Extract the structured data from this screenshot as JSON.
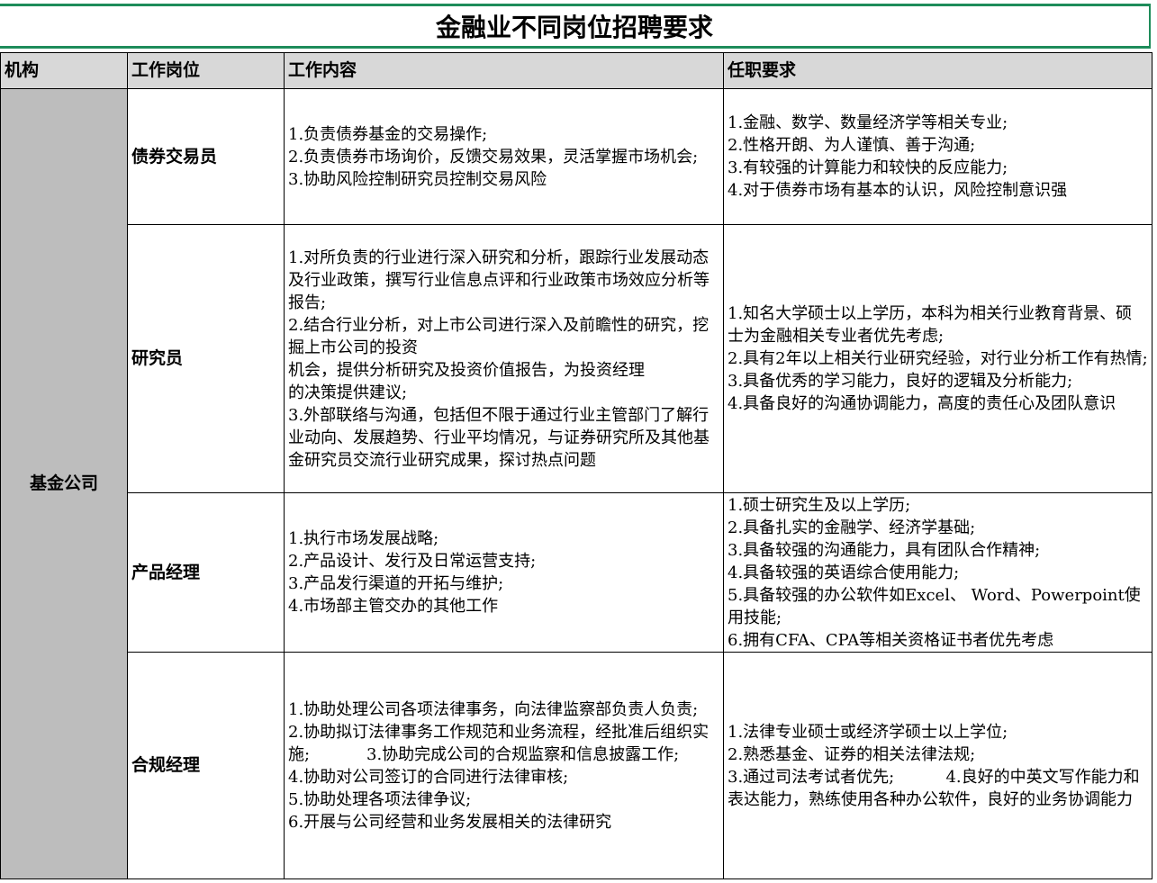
{
  "title": "金融业不同岗位招聘要求",
  "headers": {
    "org": "机构",
    "position": "工作岗位",
    "content": "工作内容",
    "requirements": "任职要求"
  },
  "org_name": "基金公司",
  "rows": [
    {
      "position": "债券交易员",
      "content": [
        "1.负责债券基金的交易操作;",
        "2.负责债券市场询价，反馈交易效果，灵活掌握市场机会;",
        "3.协助风险控制研究员控制交易风险"
      ],
      "requirements": [
        "1.金融、数学、数量经济学等相关专业;",
        "2.性格开朗、为人谨慎、善于沟通;",
        "3.有较强的计算能力和较快的反应能力;",
        "4.对于债券市场有基本的认识，风险控制意识强"
      ]
    },
    {
      "position": "研究员",
      "content": [
        "1.对所负责的行业进行深入研究和分析，跟踪行业发展动态及行业政策，撰写行业信息点评和行业政策市场效应分析等报告;",
        "2.结合行业分析，对上市公司进行深入及前瞻性的研究，挖掘上市公司的投资",
        "机会，提供分析研究及投资价值报告，为投资经理",
        "的决策提供建议;",
        "3.外部联络与沟通，包括但不限于通过行业主管部门了解行业动向、发展趋势、行业平均情况，与证券研究所及其他基金研究员交流行业研究成果，探讨热点问题"
      ],
      "requirements": [
        "1.知名大学硕士以上学历，本科为相关行业教育背景、硕士为金融相关专业者优先考虑;",
        "2.具有2年以上相关行业研究经验，对行业分析工作有热情;",
        "3.具备优秀的学习能力，良好的逻辑及分析能力;",
        "4.具备良好的沟通协调能力，高度的责任心及团队意识"
      ]
    },
    {
      "position": "产品经理",
      "content": [
        "1.执行市场发展战略;",
        "2.产品设计、发行及日常运营支持;",
        "3.产品发行渠道的开拓与维护;",
        "4.市场部主管交办的其他工作"
      ],
      "requirements": [
        "1.硕士研究生及以上学历;",
        "2.具备扎实的金融学、经济学基础;",
        "3.具备较强的沟通能力，具有团队合作精神;",
        "4.具备较强的英语综合使用能力;",
        "5.具备较强的办公软件如Excel、 Word、Powerpoint使用技能;",
        "6.拥有CFA、CPA等相关资格证书者优先考虑"
      ]
    },
    {
      "position": "合规经理",
      "content": [
        "1.协助处理公司各项法律事务，向法律监察部负责人负责;",
        "2.协助拟订法律事务工作规范和业务流程，经批准后组织实施;           3.协助完成公司的合规监察和信息披露工作;",
        "4.协助对公司签订的合同进行法律审核;",
        "5.协助处理各项法律争议;",
        "6.开展与公司经营和业务发展相关的法律研究"
      ],
      "requirements": [
        "1.法律专业硕士或经济学硕士以上学位;",
        "2.熟悉基金、证券的相关法律法规;",
        "3.通过司法考试者优先;          4.良好的中英文写作能力和表达能力，熟练使用各种办公软件，良好的业务协调能力"
      ]
    }
  ]
}
